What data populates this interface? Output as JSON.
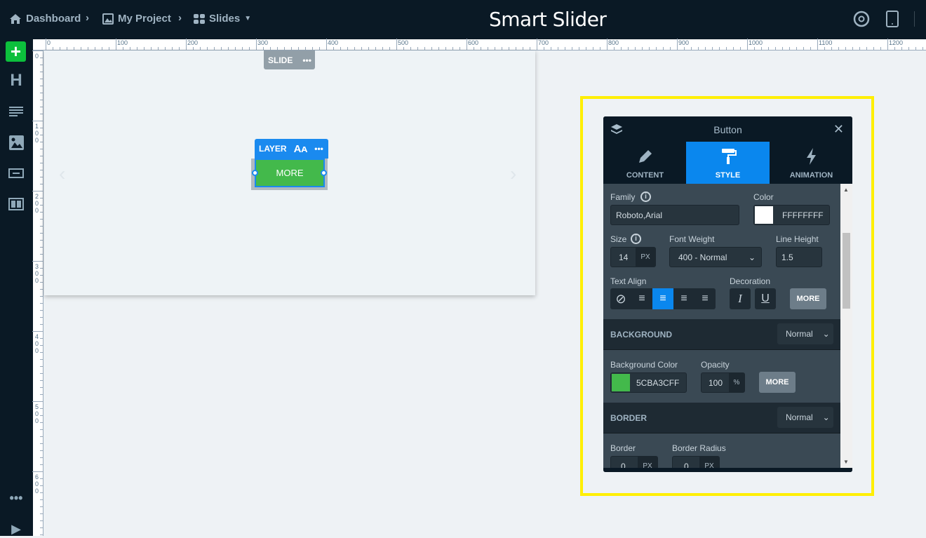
{
  "topbar": {
    "breadcrumb": [
      {
        "label": "Dashboard",
        "icon": "home-icon"
      },
      {
        "label": "My Project",
        "icon": "image-icon"
      },
      {
        "label": "Slides",
        "icon": "grid-icon"
      }
    ],
    "logo": "Smart Slider",
    "icons": [
      "eye-icon",
      "tablet-icon"
    ]
  },
  "sidebar": {
    "items": [
      "add-icon",
      "heading-icon",
      "text-icon",
      "image-icon",
      "button-icon",
      "columns-icon"
    ],
    "bottom": [
      "more-icon",
      "play-icon"
    ]
  },
  "rulers": {
    "horizontal": [
      "0",
      "100",
      "200",
      "300",
      "400",
      "500",
      "600",
      "700",
      "800",
      "900",
      "1000",
      "1100",
      "1200"
    ],
    "vertical": [
      "0",
      "100",
      "200",
      "300",
      "400",
      "500",
      "600"
    ]
  },
  "canvas": {
    "slide_label": "SLIDE",
    "layer_label": "LAYER",
    "button_text": "MORE"
  },
  "panel": {
    "title": "Button",
    "tabs": [
      {
        "label": "CONTENT"
      },
      {
        "label": "STYLE",
        "active": true
      },
      {
        "label": "ANIMATION"
      }
    ],
    "family_label": "Family",
    "family_value": "Roboto,Arial",
    "color_label": "Color",
    "color_value": "FFFFFFFF",
    "color_swatch": "#ffffff",
    "size_label": "Size",
    "size_value": "14",
    "size_unit": "PX",
    "weight_label": "Font Weight",
    "weight_value": "400 - Normal",
    "lineheight_label": "Line Height",
    "lineheight_value": "1.5",
    "align_label": "Text Align",
    "align_selected": "center",
    "decoration_label": "Decoration",
    "more": "MORE",
    "background": {
      "title": "BACKGROUND",
      "mode": "Normal",
      "color_label": "Background Color",
      "color_value": "5CBA3CFF",
      "swatch": "#43b94b",
      "opacity_label": "Opacity",
      "opacity_value": "100",
      "opacity_unit": "%"
    },
    "border": {
      "title": "BORDER",
      "mode": "Normal",
      "border_label": "Border",
      "border_value": "0",
      "border_unit": "PX",
      "radius_label": "Border Radius",
      "radius_value": "0",
      "radius_unit": "PX"
    }
  },
  "colors": {
    "accent": "#0a87ee",
    "highlight": "#ffef00",
    "add": "#0cbf3c"
  }
}
